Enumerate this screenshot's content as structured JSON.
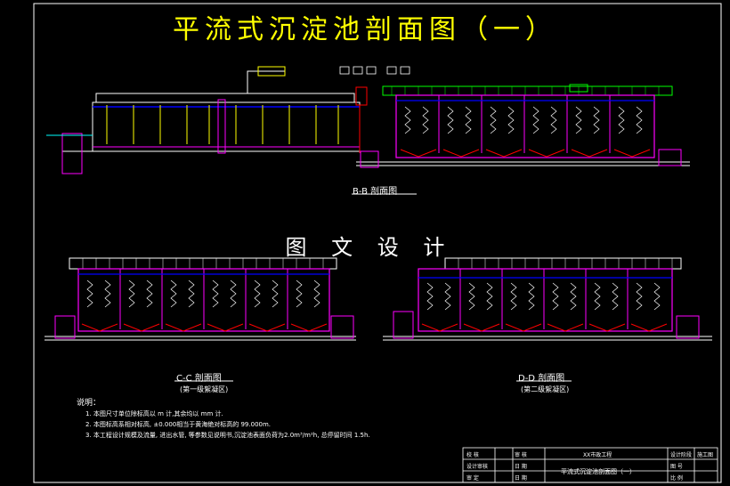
{
  "drawing": {
    "title": "平流式沉淀池剖面图（一）",
    "watermark": "图 文 设 计"
  },
  "sections": {
    "bb_label": "B-B 剖面图",
    "cc_label": "C-C 剖面图",
    "cc_sub": "(第一级絮凝区)",
    "dd_label": "D-D 剖面图",
    "dd_sub": "(第二级絮凝区)"
  },
  "notes": {
    "heading": "说明：",
    "items": [
      "1. 本图尺寸单位除标高以 m 计,其余均以 mm 计.",
      "2. 本图标高系相对标高, ±0.000相当于黄海绝对标高的 99.000m.",
      "3. 本工程设计规模及流量, 进出水管, 等参数见说明书,沉淀池表面负荷为2.0m³/m²h, 总停留时间 1.5h."
    ]
  },
  "title_block": {
    "design_unit": "XX市政工程",
    "drawing_name": "平流式沉淀池剖面图（一）",
    "rows": [
      "校 核",
      "设计审核",
      "审 定"
    ],
    "col2": [
      "审 核",
      "日 期",
      "日 期"
    ],
    "right_top": "设计阶段",
    "right_top_val": "施工图",
    "right_mid": "图 号",
    "right_bot": "比 例"
  },
  "colors": {
    "background": "#000000",
    "title": "#ffff00",
    "outline": "#ffffff",
    "structure": "#ff00ff",
    "water": "#0000ff",
    "pipe": "#ffff00",
    "grid": "#00ff00",
    "pipe_red": "#ff0000",
    "cyan": "#00ffff"
  }
}
